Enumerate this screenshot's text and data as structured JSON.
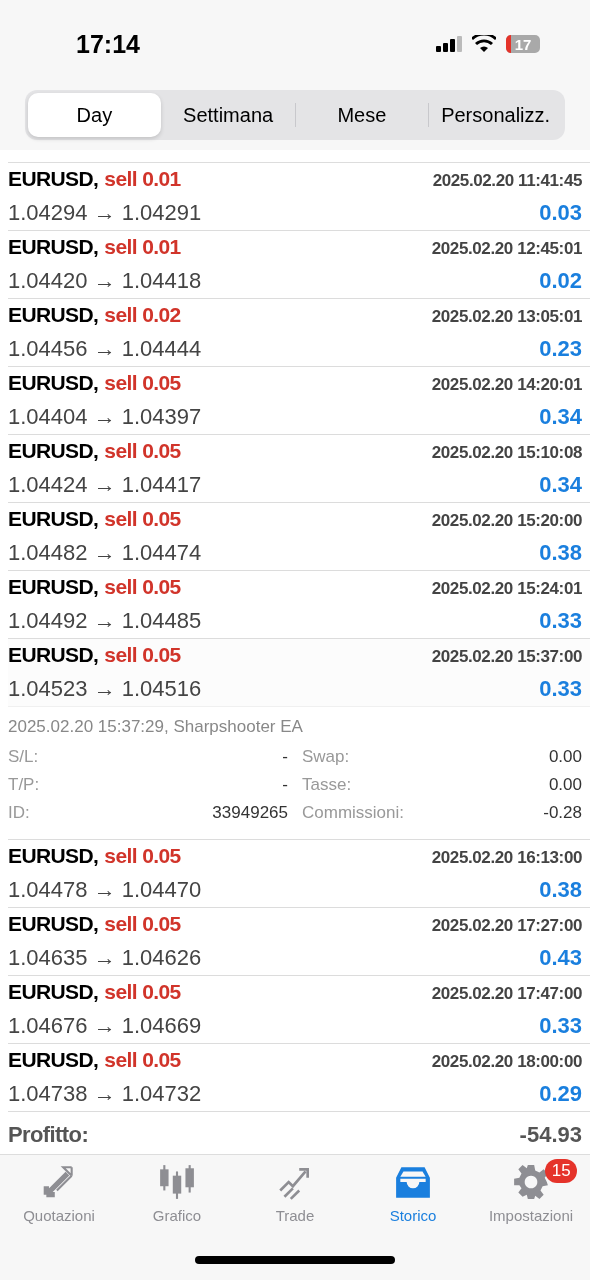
{
  "status_bar": {
    "time": "17:14",
    "battery": "17"
  },
  "segments": [
    {
      "label": "Day",
      "selected": true
    },
    {
      "label": "Settimana",
      "selected": false
    },
    {
      "label": "Mese",
      "selected": false
    },
    {
      "label": "Personalizz.",
      "selected": false
    }
  ],
  "trades": [
    {
      "symbol": "EURUSD,",
      "side": "sell 0.01",
      "time": "2025.02.20 11:41:45",
      "prices": "1.04294 → 1.04291",
      "profit": "0.03",
      "expanded": false
    },
    {
      "symbol": "EURUSD,",
      "side": "sell 0.01",
      "time": "2025.02.20 12:45:01",
      "prices": "1.04420 → 1.04418",
      "profit": "0.02",
      "expanded": false
    },
    {
      "symbol": "EURUSD,",
      "side": "sell 0.02",
      "time": "2025.02.20 13:05:01",
      "prices": "1.04456 → 1.04444",
      "profit": "0.23",
      "expanded": false
    },
    {
      "symbol": "EURUSD,",
      "side": "sell 0.05",
      "time": "2025.02.20 14:20:01",
      "prices": "1.04404 → 1.04397",
      "profit": "0.34",
      "expanded": false
    },
    {
      "symbol": "EURUSD,",
      "side": "sell 0.05",
      "time": "2025.02.20 15:10:08",
      "prices": "1.04424 → 1.04417",
      "profit": "0.34",
      "expanded": false
    },
    {
      "symbol": "EURUSD,",
      "side": "sell 0.05",
      "time": "2025.02.20 15:20:00",
      "prices": "1.04482 → 1.04474",
      "profit": "0.38",
      "expanded": false
    },
    {
      "symbol": "EURUSD,",
      "side": "sell 0.05",
      "time": "2025.02.20 15:24:01",
      "prices": "1.04492 → 1.04485",
      "profit": "0.33",
      "expanded": false
    },
    {
      "symbol": "EURUSD,",
      "side": "sell 0.05",
      "time": "2025.02.20 15:37:00",
      "prices": "1.04523 → 1.04516",
      "profit": "0.33",
      "expanded": true,
      "details": {
        "opened": "2025.02.20 15:37:29, Sharpshooter EA",
        "left": [
          {
            "label": "S/L:",
            "value": "-"
          },
          {
            "label": "T/P:",
            "value": "-"
          },
          {
            "label": "ID:",
            "value": "33949265"
          }
        ],
        "right": [
          {
            "label": "Swap:",
            "value": "0.00"
          },
          {
            "label": "Tasse:",
            "value": "0.00"
          },
          {
            "label": "Commissioni:",
            "value": "-0.28"
          }
        ]
      }
    },
    {
      "symbol": "EURUSD,",
      "side": "sell 0.05",
      "time": "2025.02.20 16:13:00",
      "prices": "1.04478 → 1.04470",
      "profit": "0.38",
      "expanded": false
    },
    {
      "symbol": "EURUSD,",
      "side": "sell 0.05",
      "time": "2025.02.20 17:27:00",
      "prices": "1.04635 → 1.04626",
      "profit": "0.43",
      "expanded": false
    },
    {
      "symbol": "EURUSD,",
      "side": "sell 0.05",
      "time": "2025.02.20 17:47:00",
      "prices": "1.04676 → 1.04669",
      "profit": "0.33",
      "expanded": false
    },
    {
      "symbol": "EURUSD,",
      "side": "sell 0.05",
      "time": "2025.02.20 18:00:00",
      "prices": "1.04738 → 1.04732",
      "profit": "0.29",
      "expanded": false
    }
  ],
  "total": {
    "label": "Profitto:",
    "value": "-54.93"
  },
  "tab_bar": [
    {
      "label": "Quotazioni",
      "selected": false
    },
    {
      "label": "Grafico",
      "selected": false
    },
    {
      "label": "Trade",
      "selected": false
    },
    {
      "label": "Storico",
      "selected": true
    },
    {
      "label": "Impostazioni",
      "selected": false,
      "badge": "15"
    }
  ]
}
